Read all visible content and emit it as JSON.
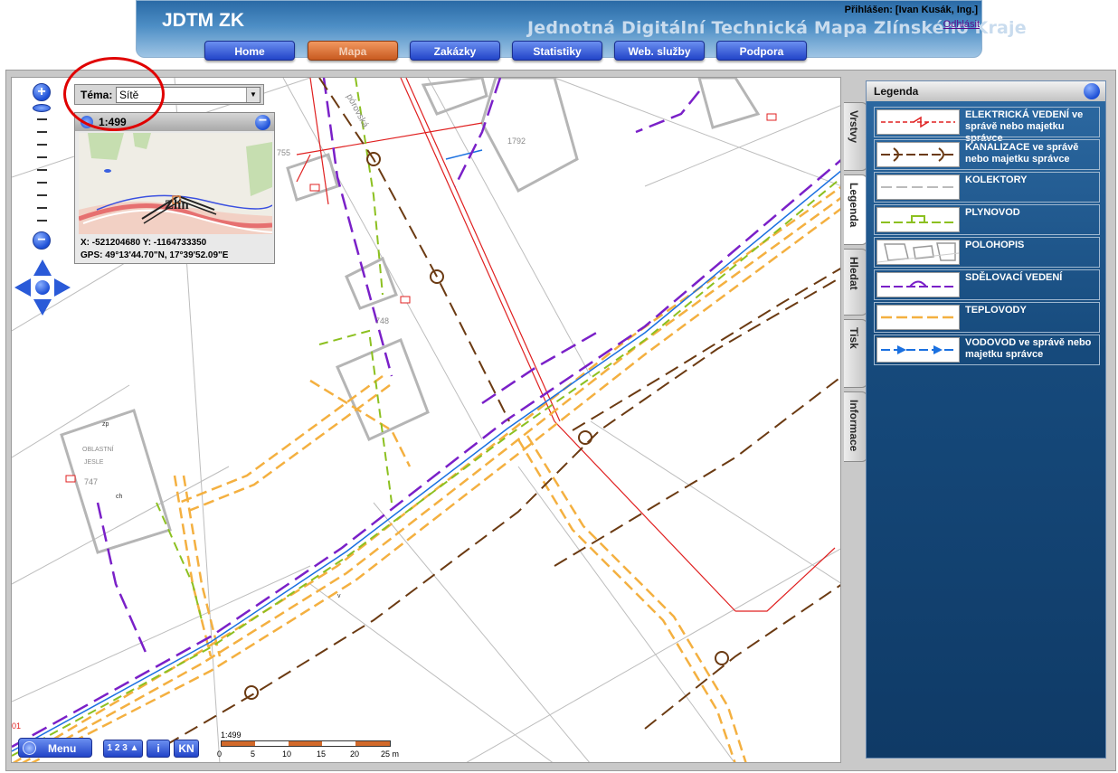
{
  "header": {
    "app_title": "JDTM ZK",
    "subtitle": "Jednotná Digitální Technická Mapa Zlínského Kraje",
    "login_info": "Přihlášen: [Ivan Kusák, Ing.]",
    "logout_label": "Odhlásit",
    "nav": [
      {
        "label": "Home",
        "active": false
      },
      {
        "label": "Mapa",
        "active": true
      },
      {
        "label": "Zakázky",
        "active": false
      },
      {
        "label": "Statistiky",
        "active": false
      },
      {
        "label": "Web. služby",
        "active": false
      },
      {
        "label": "Podpora",
        "active": false
      }
    ],
    "colors": {
      "nav_button": "#2244c8",
      "nav_active": "#c85a20",
      "header_blue": "#2a6aa6"
    }
  },
  "theme": {
    "label": "Téma:",
    "selected": "Sítě"
  },
  "overview": {
    "scale": "1:499",
    "city_label": "Zlín",
    "coords": "X: -521204680 Y: -1164733350",
    "gps": "GPS: 49°13'44.70\"N, 17°39'52.09\"E"
  },
  "map": {
    "labels": {
      "parcel_755": "755",
      "parcel_1792": "1792",
      "parcel_748": "748",
      "parcel_747": "747",
      "street": "pórovská",
      "oblast": "OBLASTNÍ",
      "jesle": "JESLE",
      "zp": "zp",
      "ch": "ch",
      "v": "v",
      "corner_num": "01"
    }
  },
  "toolbar": {
    "menu_label": "Menu",
    "numbers_label": "1 2 3",
    "info_label": "i",
    "kn_label": "KN",
    "scale_label": "1:499",
    "scale_ticks": [
      "0",
      "5",
      "10",
      "15",
      "20",
      "25 m"
    ]
  },
  "side_tabs": [
    {
      "label": "Vrstvy",
      "active": false
    },
    {
      "label": "Legenda",
      "active": true
    },
    {
      "label": "Hledat",
      "active": false
    },
    {
      "label": "Tisk",
      "active": false
    },
    {
      "label": "Informace",
      "active": false
    }
  ],
  "legend": {
    "title": "Legenda",
    "items": [
      {
        "label": "ELEKTRICKÁ VEDENÍ ve správě nebo majetku správce",
        "symbol": "electric-line",
        "color": "#e02020"
      },
      {
        "label": "KANALIZACE ve správě nebo majetku správce",
        "symbol": "sewer-line",
        "color": "#6b3a12"
      },
      {
        "label": "KOLEKTORY",
        "symbol": "collector-line",
        "color": "#bbbbbb"
      },
      {
        "label": "PLYNOVOD",
        "symbol": "gas-line",
        "color": "#8cc020"
      },
      {
        "label": "POLOHOPIS",
        "symbol": "planimetry",
        "color": "#999999"
      },
      {
        "label": "SDĚLOVACÍ VEDENÍ",
        "symbol": "telecom-line",
        "color": "#7a20c8"
      },
      {
        "label": "TEPLOVODY",
        "symbol": "heat-line",
        "color": "#f4b040"
      },
      {
        "label": "VODOVOD ve správě nebo majetku správce",
        "symbol": "water-line",
        "color": "#1a70e0"
      }
    ]
  }
}
